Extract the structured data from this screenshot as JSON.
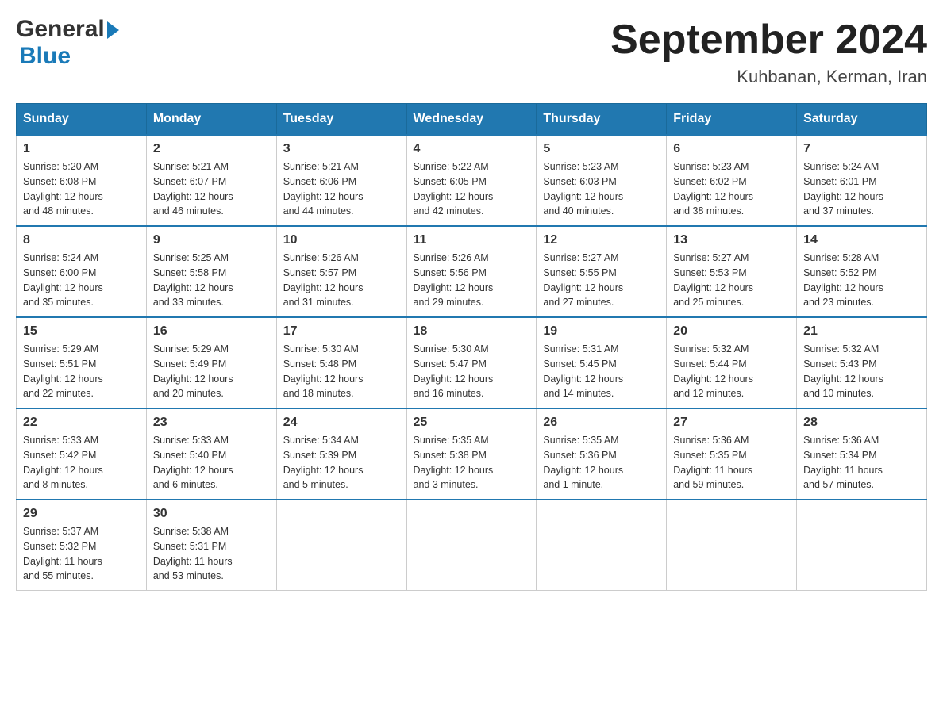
{
  "header": {
    "logo_general": "General",
    "logo_blue": "Blue",
    "month_title": "September 2024",
    "location": "Kuhbanan, Kerman, Iran"
  },
  "days_of_week": [
    "Sunday",
    "Monday",
    "Tuesday",
    "Wednesday",
    "Thursday",
    "Friday",
    "Saturday"
  ],
  "weeks": [
    [
      {
        "day": "1",
        "sunrise": "5:20 AM",
        "sunset": "6:08 PM",
        "daylight": "12 hours and 48 minutes."
      },
      {
        "day": "2",
        "sunrise": "5:21 AM",
        "sunset": "6:07 PM",
        "daylight": "12 hours and 46 minutes."
      },
      {
        "day": "3",
        "sunrise": "5:21 AM",
        "sunset": "6:06 PM",
        "daylight": "12 hours and 44 minutes."
      },
      {
        "day": "4",
        "sunrise": "5:22 AM",
        "sunset": "6:05 PM",
        "daylight": "12 hours and 42 minutes."
      },
      {
        "day": "5",
        "sunrise": "5:23 AM",
        "sunset": "6:03 PM",
        "daylight": "12 hours and 40 minutes."
      },
      {
        "day": "6",
        "sunrise": "5:23 AM",
        "sunset": "6:02 PM",
        "daylight": "12 hours and 38 minutes."
      },
      {
        "day": "7",
        "sunrise": "5:24 AM",
        "sunset": "6:01 PM",
        "daylight": "12 hours and 37 minutes."
      }
    ],
    [
      {
        "day": "8",
        "sunrise": "5:24 AM",
        "sunset": "6:00 PM",
        "daylight": "12 hours and 35 minutes."
      },
      {
        "day": "9",
        "sunrise": "5:25 AM",
        "sunset": "5:58 PM",
        "daylight": "12 hours and 33 minutes."
      },
      {
        "day": "10",
        "sunrise": "5:26 AM",
        "sunset": "5:57 PM",
        "daylight": "12 hours and 31 minutes."
      },
      {
        "day": "11",
        "sunrise": "5:26 AM",
        "sunset": "5:56 PM",
        "daylight": "12 hours and 29 minutes."
      },
      {
        "day": "12",
        "sunrise": "5:27 AM",
        "sunset": "5:55 PM",
        "daylight": "12 hours and 27 minutes."
      },
      {
        "day": "13",
        "sunrise": "5:27 AM",
        "sunset": "5:53 PM",
        "daylight": "12 hours and 25 minutes."
      },
      {
        "day": "14",
        "sunrise": "5:28 AM",
        "sunset": "5:52 PM",
        "daylight": "12 hours and 23 minutes."
      }
    ],
    [
      {
        "day": "15",
        "sunrise": "5:29 AM",
        "sunset": "5:51 PM",
        "daylight": "12 hours and 22 minutes."
      },
      {
        "day": "16",
        "sunrise": "5:29 AM",
        "sunset": "5:49 PM",
        "daylight": "12 hours and 20 minutes."
      },
      {
        "day": "17",
        "sunrise": "5:30 AM",
        "sunset": "5:48 PM",
        "daylight": "12 hours and 18 minutes."
      },
      {
        "day": "18",
        "sunrise": "5:30 AM",
        "sunset": "5:47 PM",
        "daylight": "12 hours and 16 minutes."
      },
      {
        "day": "19",
        "sunrise": "5:31 AM",
        "sunset": "5:45 PM",
        "daylight": "12 hours and 14 minutes."
      },
      {
        "day": "20",
        "sunrise": "5:32 AM",
        "sunset": "5:44 PM",
        "daylight": "12 hours and 12 minutes."
      },
      {
        "day": "21",
        "sunrise": "5:32 AM",
        "sunset": "5:43 PM",
        "daylight": "12 hours and 10 minutes."
      }
    ],
    [
      {
        "day": "22",
        "sunrise": "5:33 AM",
        "sunset": "5:42 PM",
        "daylight": "12 hours and 8 minutes."
      },
      {
        "day": "23",
        "sunrise": "5:33 AM",
        "sunset": "5:40 PM",
        "daylight": "12 hours and 6 minutes."
      },
      {
        "day": "24",
        "sunrise": "5:34 AM",
        "sunset": "5:39 PM",
        "daylight": "12 hours and 5 minutes."
      },
      {
        "day": "25",
        "sunrise": "5:35 AM",
        "sunset": "5:38 PM",
        "daylight": "12 hours and 3 minutes."
      },
      {
        "day": "26",
        "sunrise": "5:35 AM",
        "sunset": "5:36 PM",
        "daylight": "12 hours and 1 minute."
      },
      {
        "day": "27",
        "sunrise": "5:36 AM",
        "sunset": "5:35 PM",
        "daylight": "11 hours and 59 minutes."
      },
      {
        "day": "28",
        "sunrise": "5:36 AM",
        "sunset": "5:34 PM",
        "daylight": "11 hours and 57 minutes."
      }
    ],
    [
      {
        "day": "29",
        "sunrise": "5:37 AM",
        "sunset": "5:32 PM",
        "daylight": "11 hours and 55 minutes."
      },
      {
        "day": "30",
        "sunrise": "5:38 AM",
        "sunset": "5:31 PM",
        "daylight": "11 hours and 53 minutes."
      },
      null,
      null,
      null,
      null,
      null
    ]
  ],
  "labels": {
    "sunrise_prefix": "Sunrise: ",
    "sunset_prefix": "Sunset: ",
    "daylight_prefix": "Daylight: "
  }
}
